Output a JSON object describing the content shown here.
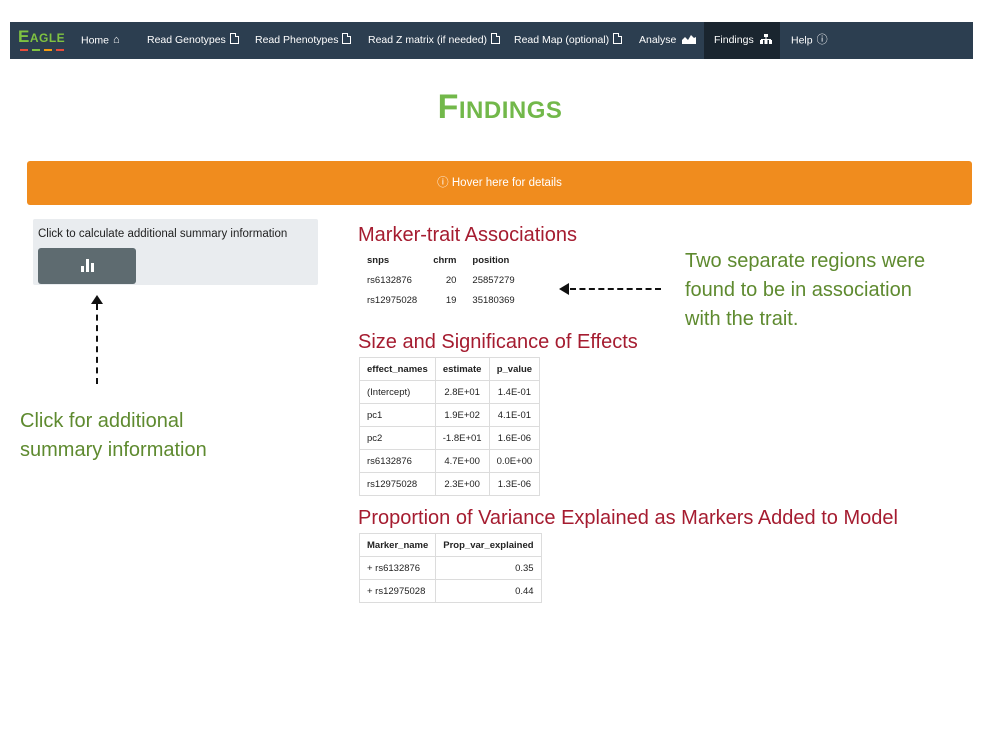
{
  "navbar": {
    "brand": "Eagle",
    "brand_colors": [
      "#e74c3c",
      "#7fc241",
      "#f39c12",
      "#e74c3c"
    ],
    "items": [
      {
        "label": "Home",
        "icon": "home-icon"
      },
      {
        "label": "Read Genotypes",
        "icon": "file-icon"
      },
      {
        "label": "Read Phenotypes",
        "icon": "file-icon"
      },
      {
        "label": "Read Z matrix (if needed)",
        "icon": "file-icon"
      },
      {
        "label": "Read Map (optional)",
        "icon": "file-icon"
      },
      {
        "label": "Analyse",
        "icon": "area-chart-icon"
      },
      {
        "label": "Findings",
        "icon": "sitemap-icon",
        "active": true
      },
      {
        "label": "Help",
        "icon": "question-circle-icon"
      }
    ]
  },
  "page": {
    "title": "Findings",
    "title_color": "#72b84a"
  },
  "banner": {
    "icon": "question-circle-icon",
    "text": "Hover here for details",
    "color": "#f08c1e"
  },
  "sidebar": {
    "label": "Click to calculate additional summary information",
    "button_icon": "bar-chart-icon"
  },
  "annotations": {
    "left_note": [
      "Click for additional",
      "summary information"
    ],
    "right_note": [
      "Two separate regions were",
      "found to be in association",
      "with the trait."
    ]
  },
  "associations": {
    "title": "Marker-trait Associations",
    "headers": [
      "snps",
      "chrm",
      "position"
    ],
    "rows": [
      [
        "rs6132876",
        "20",
        "25857279"
      ],
      [
        "rs12975028",
        "19",
        "35180369"
      ]
    ]
  },
  "effects": {
    "title": "Size and Significance of Effects",
    "headers": [
      "effect_names",
      "estimate",
      "p_value"
    ],
    "rows": [
      [
        "(Intercept)",
        "2.8E+01",
        "1.4E-01"
      ],
      [
        "pc1",
        "1.9E+02",
        "4.1E-01"
      ],
      [
        "pc2",
        "-1.8E+01",
        "1.6E-06"
      ],
      [
        "rs6132876",
        "4.7E+00",
        "0.0E+00"
      ],
      [
        "rs12975028",
        "2.3E+00",
        "1.3E-06"
      ]
    ]
  },
  "variance": {
    "title": "Proportion of Variance Explained as Markers Added to Model",
    "headers": [
      "Marker_name",
      "Prop_var_explained"
    ],
    "rows": [
      [
        "+ rs6132876",
        "0.35"
      ],
      [
        "+ rs12975028",
        "0.44"
      ]
    ]
  },
  "colors": {
    "accent_red": "#a51c30",
    "note_green": "#5e8a2f",
    "navbar": "#2c3e50"
  }
}
